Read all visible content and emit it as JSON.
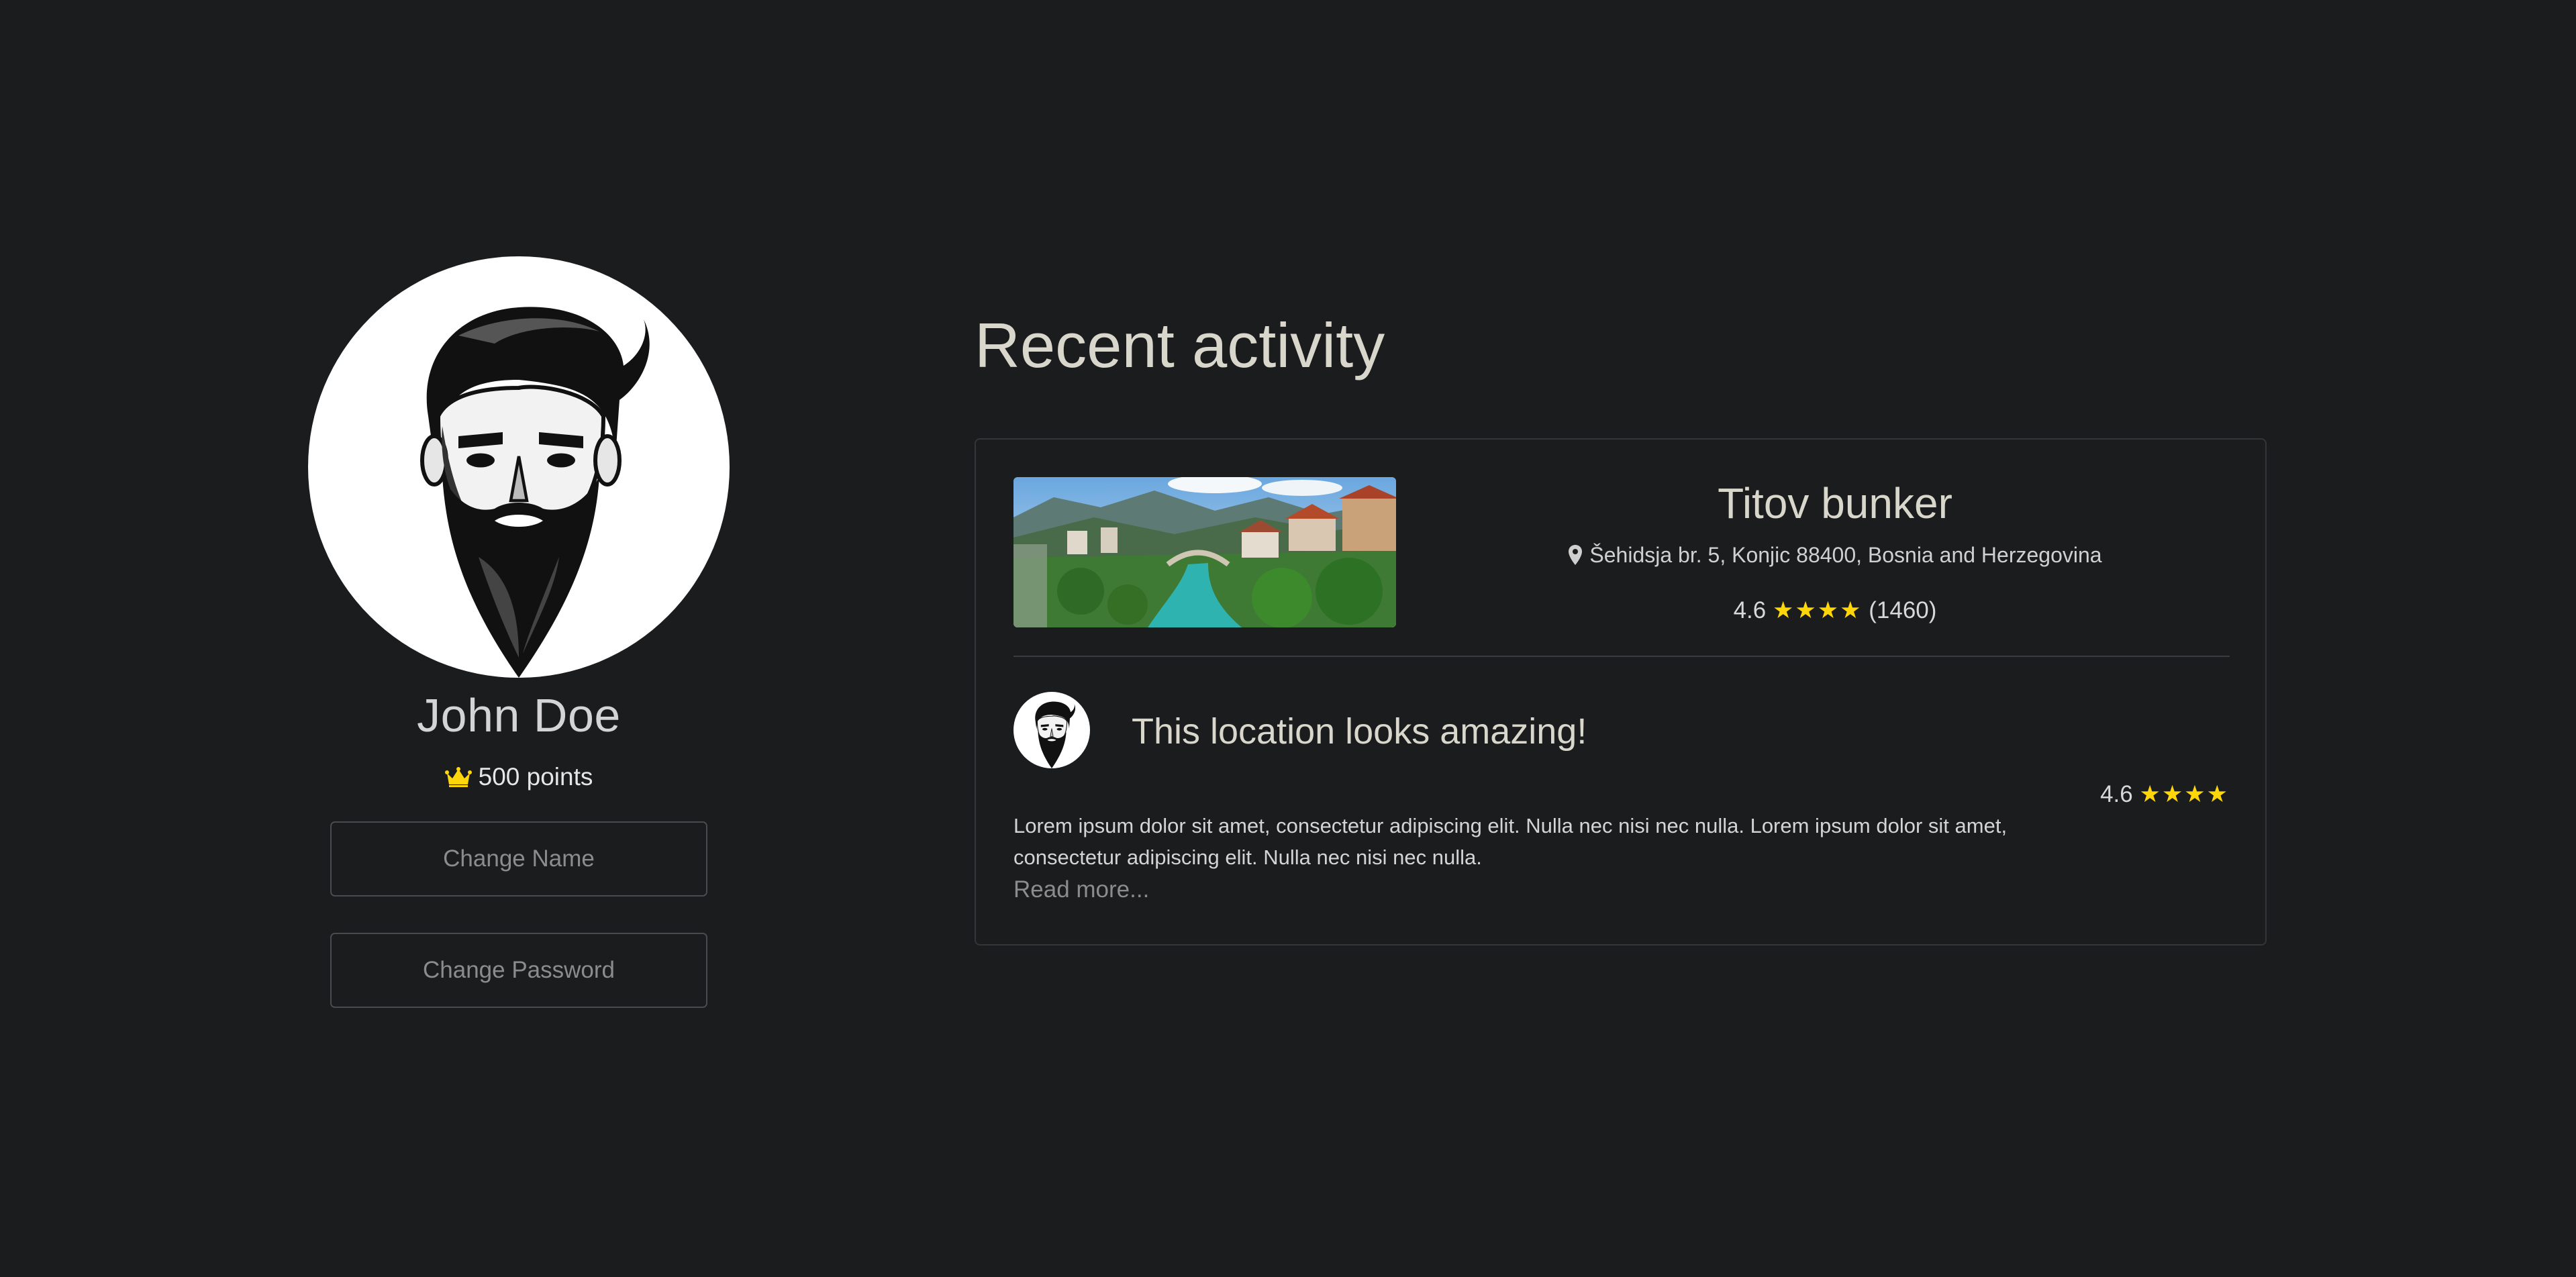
{
  "profile": {
    "avatar_icon": "bearded-man-avatar",
    "name": "John Doe",
    "points_icon": "crown-icon",
    "points_label": "500 points",
    "change_name_label": "Change Name",
    "change_password_label": "Change Password"
  },
  "activity": {
    "title": "Recent activity",
    "item": {
      "image_description": "river-town-photo",
      "place_title": "Titov bunker",
      "address_icon": "location-pin-icon",
      "address": "Šehidsja br. 5, Konjic 88400, Bosnia and Herzegovina",
      "rating_value": "4.6",
      "rating_stars": "★★★★",
      "rating_count": "(1460)",
      "review": {
        "avatar_icon": "bearded-man-avatar",
        "title": "This location looks amazing!",
        "rating_value": "4.6",
        "rating_stars": "★★★★",
        "body": "Lorem ipsum dolor sit amet, consectetur adipiscing elit. Nulla nec nisi nec nulla. Lorem ipsum dolor sit amet, consectetur adipiscing elit. Nulla nec nisi nec nulla.",
        "read_more_label": "Read more..."
      }
    }
  },
  "colors": {
    "background": "#1b1c1e",
    "star": "#ffd60a",
    "crown": "#ffd60a",
    "muted_text": "#8c8c8c",
    "border": "#4a4b4e"
  }
}
